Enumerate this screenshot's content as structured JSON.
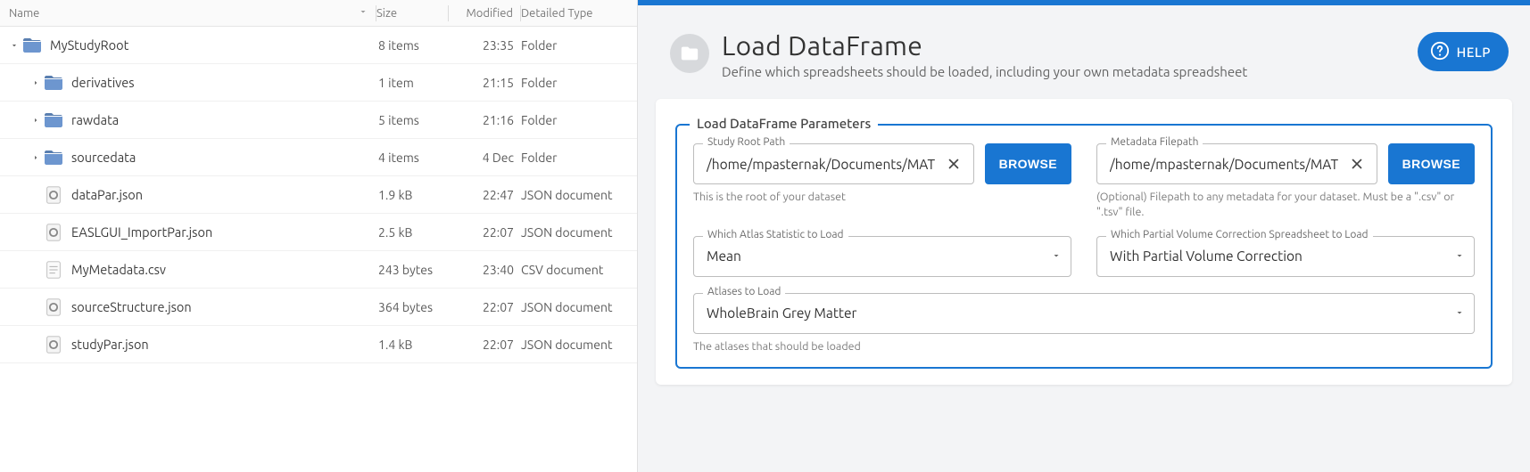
{
  "file_browser": {
    "columns": {
      "name": "Name",
      "size": "Size",
      "modified": "Modified",
      "type": "Detailed Type"
    },
    "rows": [
      {
        "indent": 0,
        "expander": "down",
        "icon": "folder",
        "name": "MyStudyRoot",
        "size": "8 items",
        "modified": "23:35",
        "type": "Folder"
      },
      {
        "indent": 1,
        "expander": "right",
        "icon": "folder",
        "name": "derivatives",
        "size": "1 item",
        "modified": "21:15",
        "type": "Folder"
      },
      {
        "indent": 1,
        "expander": "right",
        "icon": "folder",
        "name": "rawdata",
        "size": "5 items",
        "modified": "21:16",
        "type": "Folder"
      },
      {
        "indent": 1,
        "expander": "right",
        "icon": "folder",
        "name": "sourcedata",
        "size": "4 items",
        "modified": "4 Dec",
        "type": "Folder"
      },
      {
        "indent": 1,
        "expander": "none",
        "icon": "json",
        "name": "dataPar.json",
        "size": "1.9 kB",
        "modified": "22:47",
        "type": "JSON document"
      },
      {
        "indent": 1,
        "expander": "none",
        "icon": "json",
        "name": "EASLGUI_ImportPar.json",
        "size": "2.5 kB",
        "modified": "22:07",
        "type": "JSON document"
      },
      {
        "indent": 1,
        "expander": "none",
        "icon": "text",
        "name": "MyMetadata.csv",
        "size": "243 bytes",
        "modified": "23:40",
        "type": "CSV document"
      },
      {
        "indent": 1,
        "expander": "none",
        "icon": "json",
        "name": "sourceStructure.json",
        "size": "364 bytes",
        "modified": "22:07",
        "type": "JSON document"
      },
      {
        "indent": 1,
        "expander": "none",
        "icon": "json",
        "name": "studyPar.json",
        "size": "1.4 kB",
        "modified": "22:07",
        "type": "JSON document"
      }
    ]
  },
  "page": {
    "title": "Load DataFrame",
    "subtitle": "Define which spreadsheets should be loaded, including your own metadata spreadsheet",
    "help_label": "HELP"
  },
  "form": {
    "legend": "Load DataFrame Parameters",
    "study_root": {
      "label": "Study Root Path",
      "value": "/home/mpasternak/Documents/MAT",
      "browse": "BROWSE",
      "helper": "This is the root of your dataset"
    },
    "metadata": {
      "label": "Metadata Filepath",
      "value": "/home/mpasternak/Documents/MAT",
      "browse": "BROWSE",
      "helper": "(Optional) Filepath to any metadata for your dataset. Must be a \".csv\" or \".tsv\" file."
    },
    "atlas_stat": {
      "label": "Which Atlas Statistic to Load",
      "value": "Mean"
    },
    "pvc": {
      "label": "Which Partial Volume Correction Spreadsheet to Load",
      "value": "With Partial Volume Correction"
    },
    "atlases": {
      "label": "Atlases to Load",
      "value": "WholeBrain Grey Matter",
      "helper": "The atlases that should be loaded"
    }
  }
}
